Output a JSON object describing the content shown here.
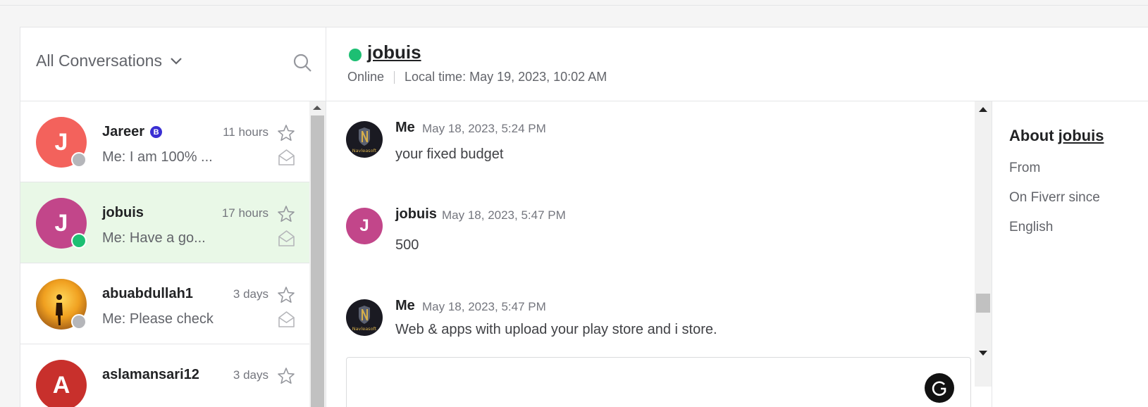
{
  "sidebar": {
    "filter_label": "All Conversations",
    "conversations": [
      {
        "avatar_letter": "J",
        "avatar_color": "#f3625c",
        "name": "Jareer",
        "badge": "B",
        "time": "11 hours",
        "snippet": "Me: I am 100% ...",
        "status_color": "#b5b6ba",
        "active": false
      },
      {
        "avatar_letter": "J",
        "avatar_color": "#c2468a",
        "name": "jobuis",
        "badge": "",
        "time": "17 hours",
        "snippet": "Me: Have a go...",
        "status_color": "#1dbf73",
        "active": true
      },
      {
        "avatar_letter": "",
        "avatar_color": "#e79b1e",
        "name": "abuabdullah1",
        "badge": "",
        "time": "3 days",
        "snippet": "Me: Please check",
        "status_color": "#b5b6ba",
        "active": false
      },
      {
        "avatar_letter": "A",
        "avatar_color": "#c8302c",
        "name": "aslamansari12",
        "badge": "",
        "time": "3 days",
        "snippet": "",
        "status_color": "#b5b6ba",
        "active": false
      }
    ]
  },
  "chat": {
    "username": "jobuis",
    "status": "Online",
    "local_time": "Local time: May 19, 2023, 10:02 AM",
    "messages": [
      {
        "sender": "Me",
        "time": "May 18, 2023, 5:24 PM",
        "text": "your fixed budget",
        "avatar": "logo"
      },
      {
        "sender": "jobuis",
        "time": "May 18, 2023, 5:47 PM",
        "text": "500",
        "avatar": "J"
      },
      {
        "sender": "Me",
        "time": "May 18, 2023, 5:47 PM",
        "text": "Web & apps with upload your play store and i store.",
        "avatar": "logo"
      }
    ],
    "logo_text": "Navleasoft"
  },
  "about": {
    "title_prefix": "About",
    "title_user": "jobuis",
    "rows": [
      "From",
      "On Fiverr since",
      "English"
    ]
  },
  "colors": {
    "online": "#1dbf73",
    "offline": "#b5b6ba",
    "active_row": "#e9f8e7",
    "pro_badge": "#3a2fd3"
  }
}
